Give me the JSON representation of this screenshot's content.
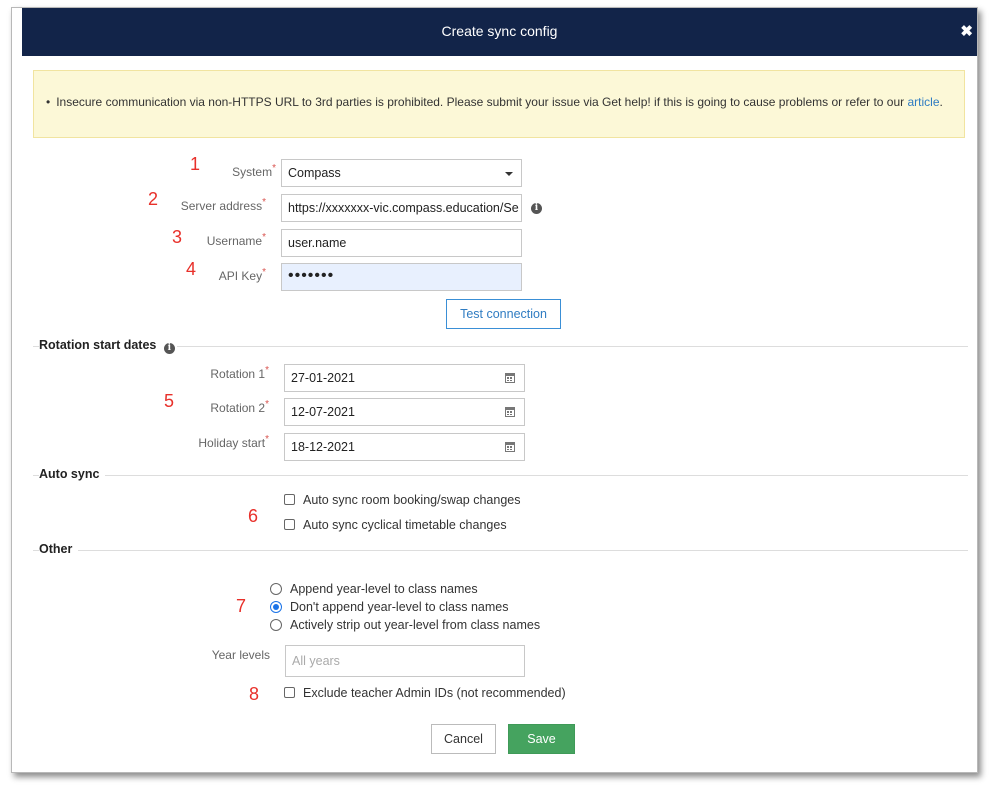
{
  "dialog": {
    "title": "Create sync config",
    "close_symbol": "✖"
  },
  "notice": {
    "bullet": "•",
    "text": "Insecure communication via non-HTTPS URL to 3rd parties is prohibited. Please submit your issue via Get help! if this is going to cause problems or refer to our",
    "link_text": "article",
    "suffix": "."
  },
  "connection": {
    "system": {
      "number": "1",
      "label": "System",
      "value": "Compass"
    },
    "server": {
      "number": "2",
      "label": "Server address",
      "value": "https://xxxxxxx-vic.compass.education/Se"
    },
    "username": {
      "number": "3",
      "label": "Username",
      "value": "user.name"
    },
    "api_key": {
      "number": "4",
      "label": "API Key",
      "value": "•••••••"
    },
    "test_button": "Test connection",
    "required_mark": "*",
    "info_glyph": "i"
  },
  "rotation": {
    "section_title": "Rotation start dates",
    "number": "5",
    "rotation1": {
      "label": "Rotation 1",
      "value": "27-01-2021"
    },
    "rotation2": {
      "label": "Rotation 2",
      "value": "12-07-2021"
    },
    "holiday": {
      "label": "Holiday start",
      "value": "18-12-2021"
    }
  },
  "auto_sync": {
    "section_title": "Auto sync",
    "number": "6",
    "option1": "Auto sync room booking/swap changes",
    "option2": "Auto sync cyclical timetable changes"
  },
  "other": {
    "section_title": "Other",
    "number7": "7",
    "radio1": "Append year-level to class names",
    "radio2": "Don't append year-level to class names",
    "radio3": "Actively strip out year-level from class names",
    "year_levels_label": "Year levels",
    "year_levels_placeholder": "All years",
    "number8": "8",
    "exclude_label": "Exclude teacher Admin IDs (not recommended)"
  },
  "footer": {
    "cancel": "Cancel",
    "save": "Save"
  },
  "colors": {
    "header_bg": "#122449",
    "notice_bg": "#fcf8d7",
    "save_bg": "#45a35f",
    "link": "#2f7cc2",
    "number_red": "#e8302a"
  }
}
